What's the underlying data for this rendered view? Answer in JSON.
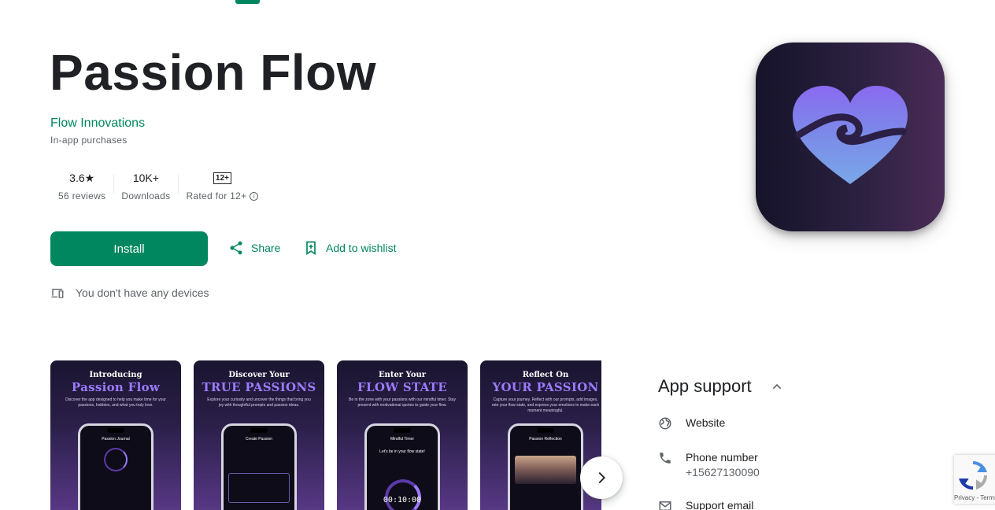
{
  "app": {
    "title": "Passion Flow",
    "developer": "Flow Innovations",
    "in_app_purchases": "In-app purchases"
  },
  "stats": {
    "rating_value": "3.6★",
    "rating_label": "56 reviews",
    "downloads_value": "10K+",
    "downloads_label": "Downloads",
    "content_rating_badge": "12+",
    "content_rating_label": "Rated for 12+"
  },
  "actions": {
    "install": "Install",
    "share": "Share",
    "wishlist": "Add to wishlist"
  },
  "devices_message": "You don't have any devices",
  "screenshots": [
    {
      "line1": "Introducing",
      "line2": "Passion Flow",
      "desc": "Discover the app designed to help you make time for your passions, hobbies, and what you truly love.",
      "phone_title": "Passion Journal"
    },
    {
      "line1": "Discover Your",
      "line2": "TRUE PASSIONS",
      "desc": "Explore your curiosity and uncover the things that bring you joy with thoughtful prompts and passion ideas.",
      "phone_title": "Create Passion"
    },
    {
      "line1": "Enter Your",
      "line2": "FLOW STATE",
      "desc": "Be in the zone with your passions with our mindful timer. Stay present with motivational quotes to guide your flow.",
      "phone_title": "Mindful Timer",
      "phone_text": "Let's be in your flow state!",
      "phone_timer": "00:10:00"
    },
    {
      "line1": "Reflect On",
      "line2": "YOUR PASSION",
      "desc": "Capture your journey. Reflect with our prompts, add images, rate your flow state, and express your emotions to make each moment meaningful.",
      "phone_title": "Passion Reflection"
    }
  ],
  "support": {
    "title": "App support",
    "website_label": "Website",
    "phone_label": "Phone number",
    "phone_value": "+15627130090",
    "email_label": "Support email"
  },
  "recaptcha": {
    "links": "Privacy - Terms"
  },
  "colors": {
    "accent": "#01875f",
    "icon_bg_dark": "#15132a",
    "icon_bg_light": "#4a2c57"
  }
}
